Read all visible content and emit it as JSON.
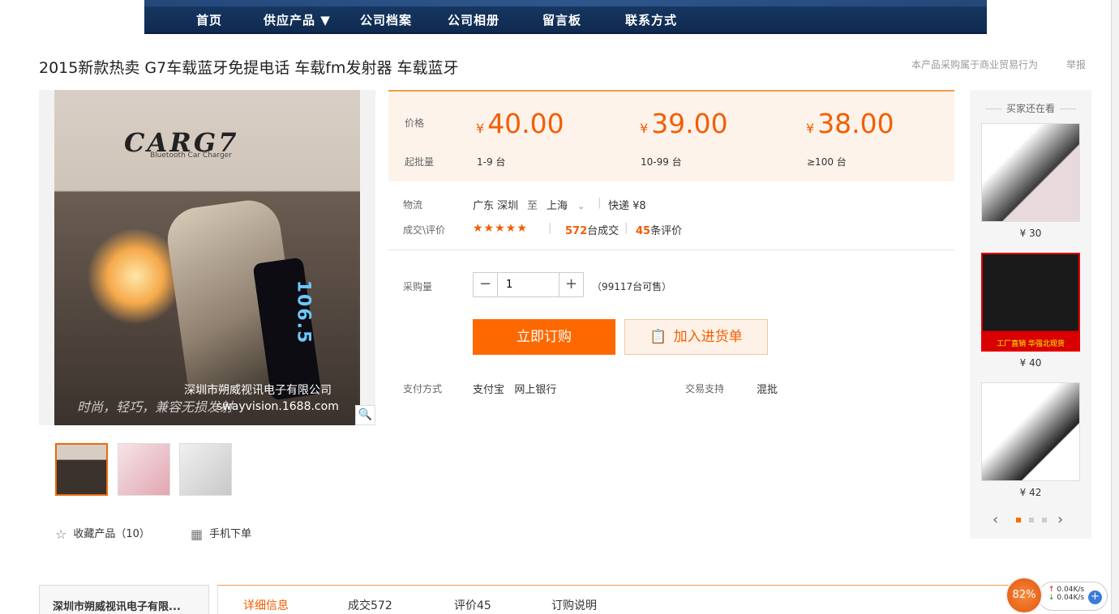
{
  "nav": [
    "首页",
    "供应产品 ▼",
    "公司档案",
    "公司相册",
    "留言板",
    "联系方式"
  ],
  "title": "2015新款热卖 G7车载蓝牙免提电话 车载fm发射器 车载蓝牙",
  "title_note": "本产品采购属于商业贸易行为",
  "report": "举报",
  "main_image": {
    "brand": "CARG7",
    "brand_sub": "Bluetooth Car Charger",
    "screen": "106.5",
    "company": "深圳市朔威视讯电子有限公司",
    "slogan": "时尚，轻巧，兼容无损发射",
    "url": "swayvision.1688.com"
  },
  "price": {
    "price_label": "价格",
    "min_label": "起批量",
    "tiers": [
      {
        "price": "40.00",
        "qty": "1-9 台"
      },
      {
        "price": "39.00",
        "qty": "10-99 台"
      },
      {
        "price": "38.00",
        "qty": "≥100 台"
      }
    ],
    "currency": "¥"
  },
  "logistics": {
    "label": "物流",
    "from": "广东 深圳",
    "to_word": "至",
    "to": "上海",
    "express": "快递 ¥8"
  },
  "deals": {
    "label": "成交\\评价",
    "stars": "★★★★★",
    "sold_num": "572",
    "sold_suffix": "台成交",
    "review_num": "45",
    "review_suffix": "条评价"
  },
  "purchase": {
    "label": "采购量",
    "minus": "−",
    "plus": "+",
    "qty": "1",
    "stock": "（99117台可售）"
  },
  "buttons": {
    "buy": "立即订购",
    "cart": "加入进货单"
  },
  "payment": {
    "label": "支付方式",
    "methods": "支付宝   网上银行",
    "trade_label": "交易支持",
    "trade": "混批"
  },
  "favorites": "收藏产品（10）",
  "mobile_order": "手机下单",
  "side": {
    "title": "买家还在看",
    "items": [
      {
        "price": "¥ 30"
      },
      {
        "price": "¥ 40",
        "caption": "工厂直销 华强北现货"
      },
      {
        "price": "¥ 42"
      }
    ],
    "prev": "‹",
    "next": "›"
  },
  "company_name": "深圳市朔威视讯电子有限...",
  "tabs": [
    "详细信息",
    "成交572",
    "评价45",
    "订购说明"
  ],
  "speed": {
    "percent": "82%",
    "up": "0.04K/s",
    "down": "0.04K/s"
  },
  "colors": {
    "accent": "#fd6900",
    "price": "#f45d00",
    "nav": "#15355f"
  }
}
